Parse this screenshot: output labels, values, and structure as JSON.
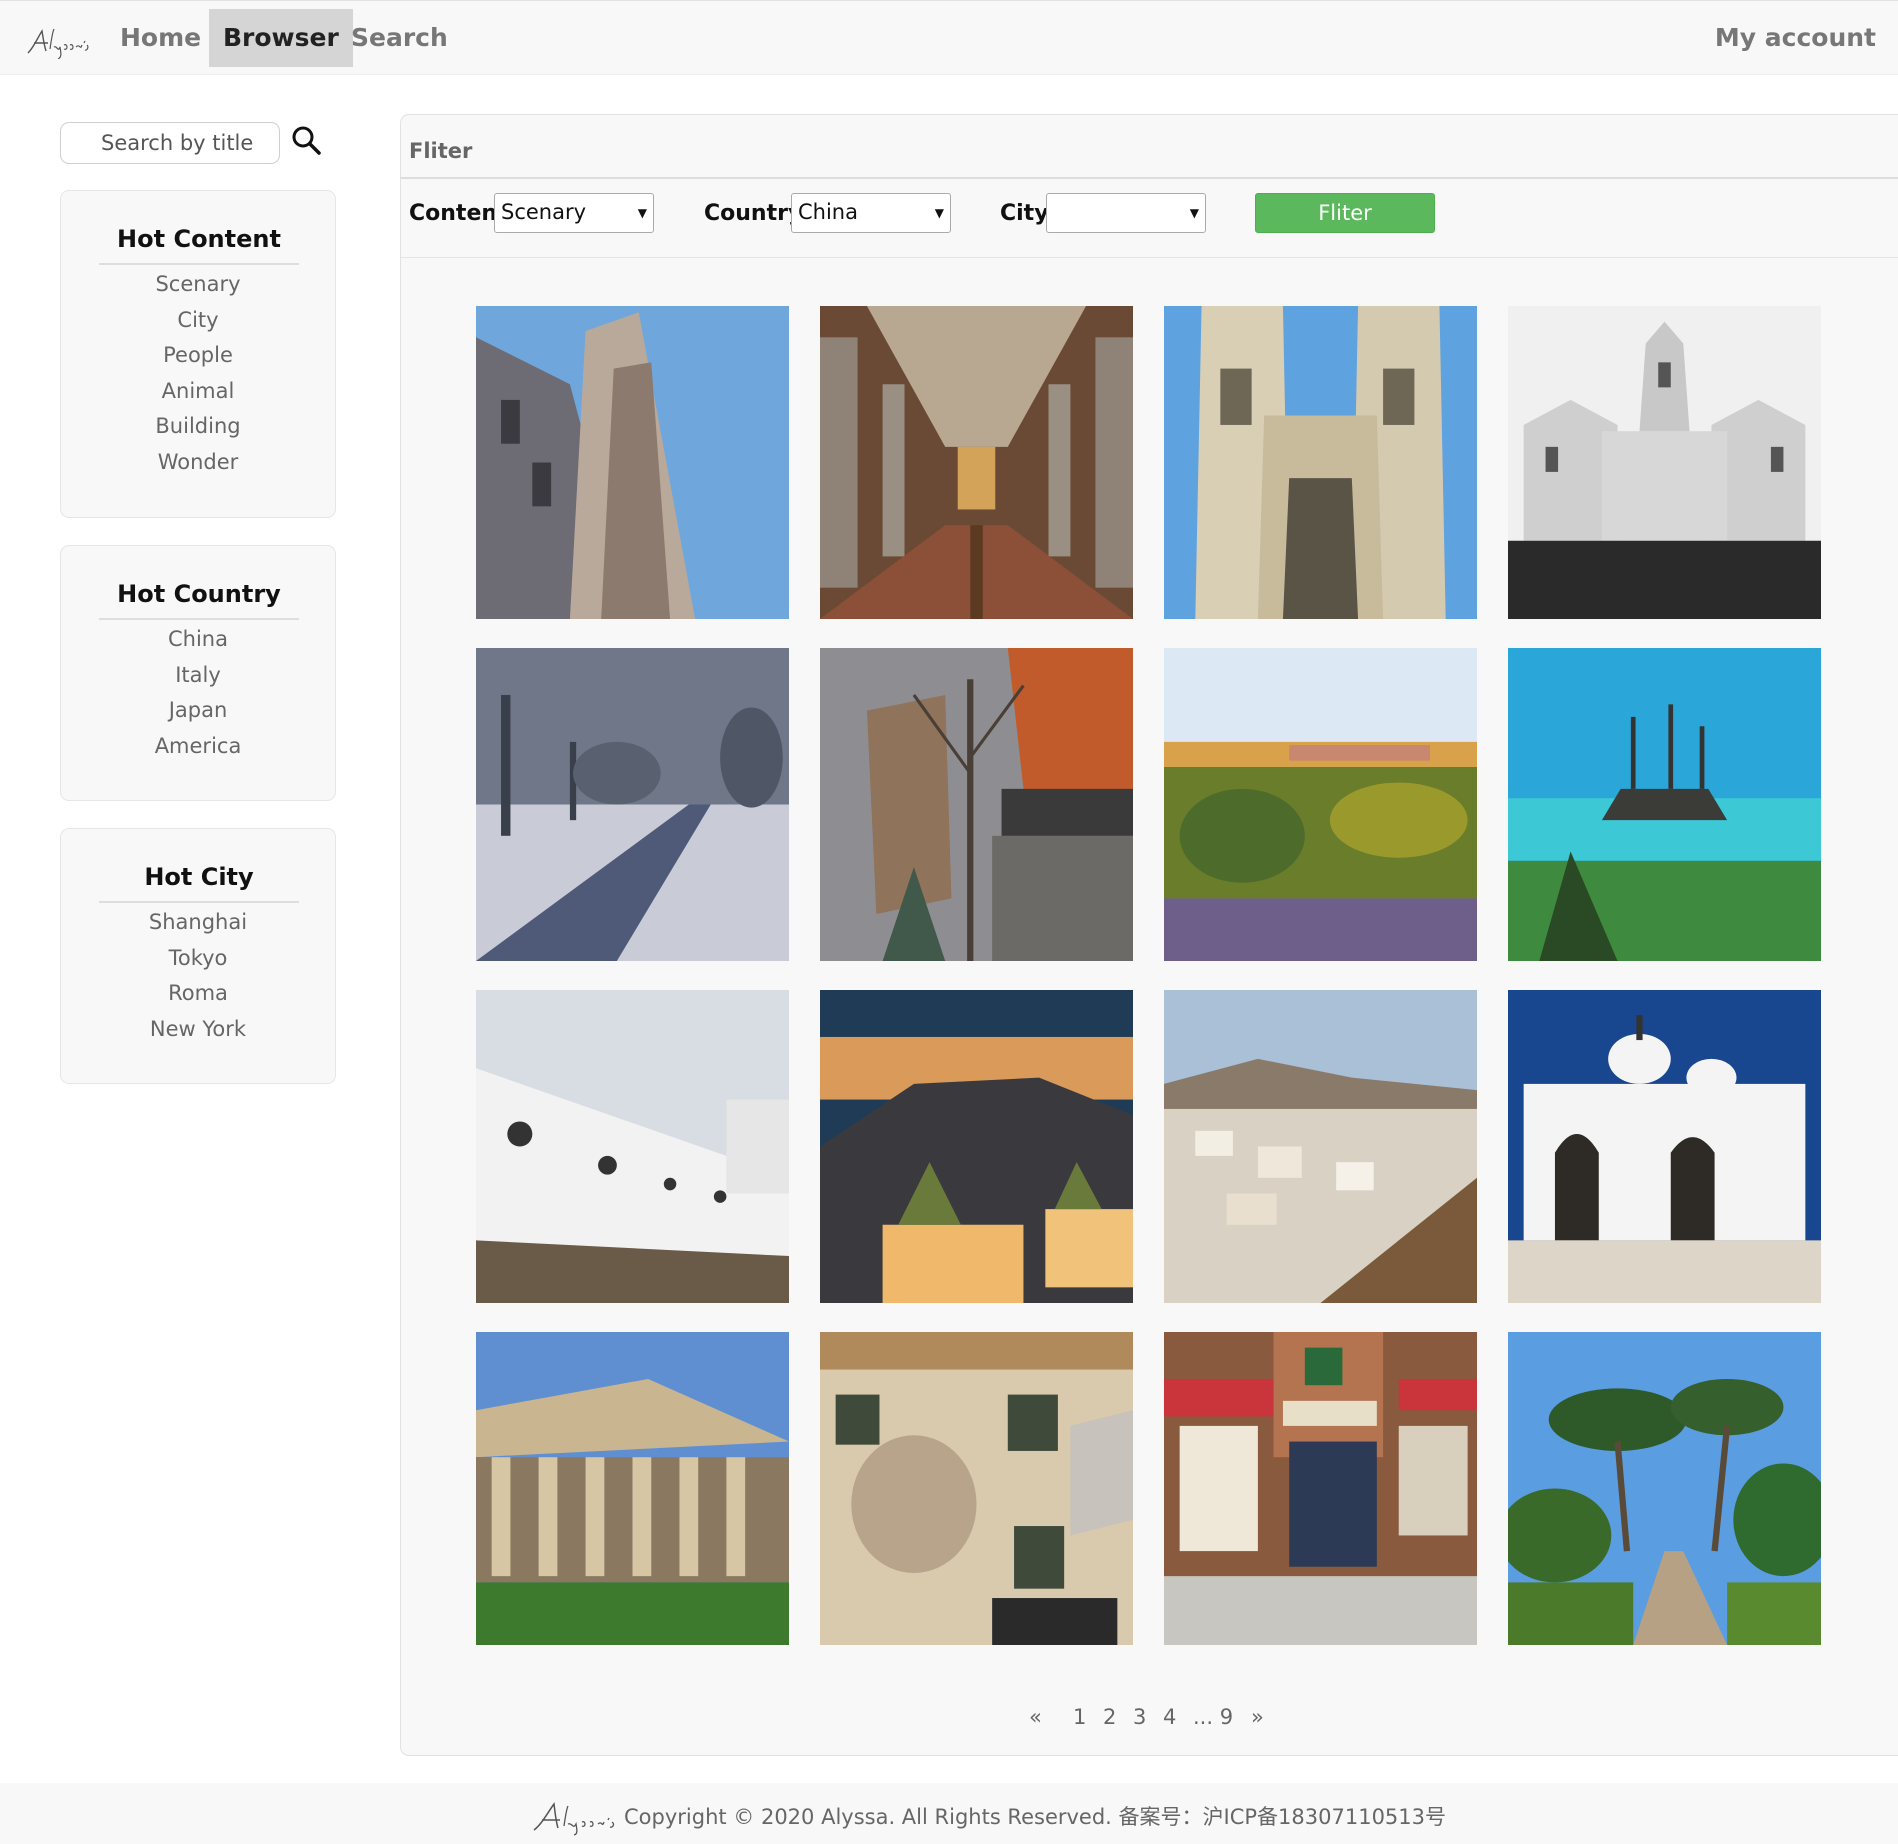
{
  "nav": {
    "logo_text": "Alyssa's",
    "links": [
      "Home",
      "Browser",
      "Search"
    ],
    "active": "Browser",
    "account": "My account"
  },
  "sidebar": {
    "search_placeholder": "Search by title",
    "hot_content": {
      "title": "Hot Content",
      "items": [
        "Scenary",
        "City",
        "People",
        "Animal",
        "Building",
        "Wonder"
      ]
    },
    "hot_country": {
      "title": "Hot Country",
      "items": [
        "China",
        "Italy",
        "Japan",
        "America"
      ]
    },
    "hot_city": {
      "title": "Hot City",
      "items": [
        "Shanghai",
        "Tokyo",
        "Roma",
        "New York"
      ]
    }
  },
  "filter": {
    "header": "Fliter",
    "content_label": "Content",
    "content_value": "Scenary",
    "country_label": "Country",
    "country_value": "China",
    "city_label": "City",
    "city_value": "",
    "button": "Fliter"
  },
  "photos": [
    "photo-cathedral-tower",
    "photo-basilica-nave",
    "photo-gothic-abbey",
    "photo-white-palace",
    "photo-snowy-road",
    "photo-winter-tree",
    "photo-autumn-meadow",
    "photo-pirate-ship",
    "photo-white-wall",
    "photo-dusk-terrace",
    "photo-hillside-village",
    "photo-white-chapel",
    "photo-greek-temple",
    "photo-painted-facade",
    "photo-sax-wine-bar",
    "photo-pine-path"
  ],
  "pagination": {
    "prev": "«",
    "pages": [
      "1",
      "2",
      "3",
      "4"
    ],
    "ellipsis": "... 9",
    "next": "»"
  },
  "footer": {
    "logo_text": "Alyssa's",
    "text": "Copyright © 2020 Alyssa. All Rights Reserved. 备案号：沪ICP备18307110513号"
  },
  "colors": {
    "filter_button": "#5cb85c",
    "nav_active": "#d5d5d5",
    "panel_bg": "#f8f8f8"
  }
}
